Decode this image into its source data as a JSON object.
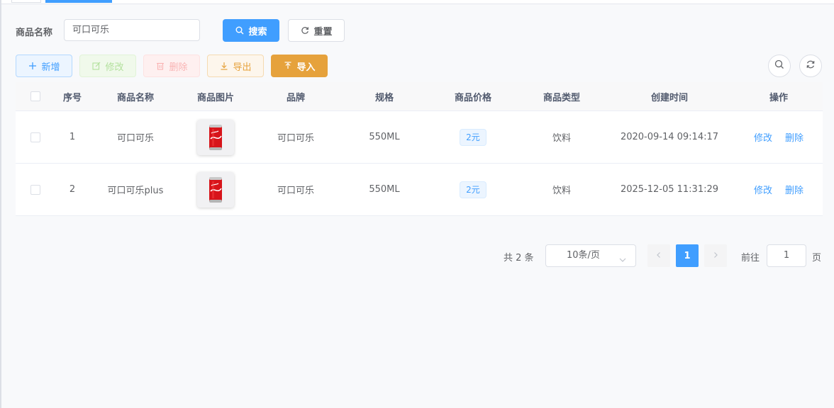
{
  "search": {
    "label": "商品名称",
    "value": "可口可乐",
    "search_button": "搜索",
    "reset_button": "重置"
  },
  "toolbar": {
    "add": "新增",
    "edit": "修改",
    "delete": "删除",
    "export": "导出",
    "import": "导入"
  },
  "table": {
    "headers": {
      "index": "序号",
      "name": "商品名称",
      "image": "商品图片",
      "brand": "品牌",
      "spec": "规格",
      "price": "商品价格",
      "type": "商品类型",
      "created": "创建时间",
      "ops": "操作"
    },
    "rows": [
      {
        "index": "1",
        "name": "可口可乐",
        "brand": "可口可乐",
        "spec": "550ML",
        "price": "2元",
        "type": "饮料",
        "created": "2020-09-14 09:14:17",
        "edit": "修改",
        "delete": "删除"
      },
      {
        "index": "2",
        "name": "可口可乐plus",
        "brand": "可口可乐",
        "spec": "550ML",
        "price": "2元",
        "type": "饮料",
        "created": "2025-12-05 11:31:29",
        "edit": "修改",
        "delete": "删除"
      }
    ]
  },
  "pagination": {
    "total": "共 2 条",
    "page_size": "10条/页",
    "current_page": "1",
    "goto_label": "前往",
    "goto_value": "1",
    "page_suffix": "页"
  },
  "colors": {
    "primary": "#409eff",
    "warning": "#e6a23c",
    "success_light": "#b3e19d",
    "danger_light": "#f9b4b4"
  }
}
